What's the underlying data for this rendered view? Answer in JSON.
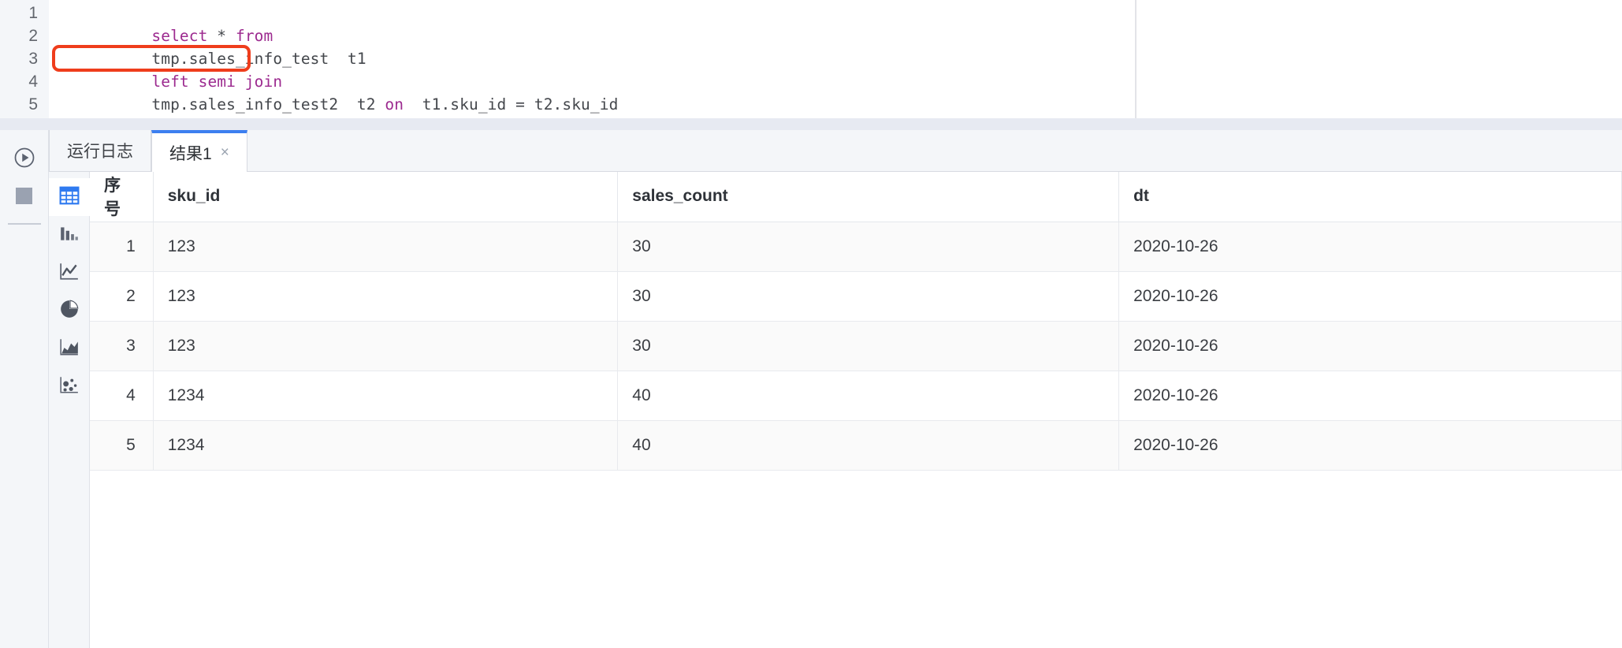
{
  "editor": {
    "line_numbers": [
      "1",
      "2",
      "3",
      "4",
      "5"
    ],
    "lines": [
      {
        "segments": [
          {
            "text": "select ",
            "type": "kw"
          },
          {
            "text": "* ",
            "type": "plain"
          },
          {
            "text": "from",
            "type": "kw"
          }
        ]
      },
      {
        "segments": [
          {
            "text": "tmp.sales_info_test  t1",
            "type": "plain"
          }
        ]
      },
      {
        "segments": [
          {
            "text": "left semi join",
            "type": "kw"
          }
        ]
      },
      {
        "segments": [
          {
            "text": "tmp.sales_info_test2  t2 ",
            "type": "plain"
          },
          {
            "text": "on",
            "type": "kw"
          },
          {
            "text": "  t1.sku_id = t2.sku_id",
            "type": "plain"
          }
        ]
      },
      {
        "segments": []
      }
    ],
    "highlight": {
      "target_line": 3,
      "target_text": "left semi join",
      "color": "#ef3d1c"
    },
    "keyword_color": "#9c2a8f",
    "text_color": "#44474c"
  },
  "run_rail": {
    "items": [
      {
        "icon": "run-play-icon",
        "label": "运行"
      },
      {
        "icon": "stop-square-icon",
        "label": "停止"
      }
    ]
  },
  "tabs": [
    {
      "label": "运行日志",
      "active": false,
      "closable": false
    },
    {
      "label": "结果1",
      "active": true,
      "closable": true,
      "close_label": "×"
    }
  ],
  "viz_rail": {
    "active_index": 0,
    "items": [
      {
        "icon": "table-grid-icon",
        "label": "表格"
      },
      {
        "icon": "bar-chart-icon",
        "label": "柱状图"
      },
      {
        "icon": "line-chart-icon",
        "label": "折线图"
      },
      {
        "icon": "pie-chart-icon",
        "label": "饼图"
      },
      {
        "icon": "area-chart-icon",
        "label": "面积图"
      },
      {
        "icon": "scatter-plot-icon",
        "label": "散点图"
      }
    ]
  },
  "result_table": {
    "columns": [
      "序号",
      "sku_id",
      "sales_count",
      "dt"
    ],
    "rows": [
      {
        "序号": "1",
        "sku_id": "123",
        "sales_count": "30",
        "dt": "2020-10-26"
      },
      {
        "序号": "2",
        "sku_id": "123",
        "sales_count": "30",
        "dt": "2020-10-26"
      },
      {
        "序号": "3",
        "sku_id": "123",
        "sales_count": "30",
        "dt": "2020-10-26"
      },
      {
        "序号": "4",
        "sku_id": "1234",
        "sales_count": "40",
        "dt": "2020-10-26"
      },
      {
        "序号": "5",
        "sku_id": "1234",
        "sales_count": "40",
        "dt": "2020-10-26"
      }
    ]
  },
  "colors": {
    "accent_blue": "#3d7ff0",
    "table_icon_blue": "#2f7af0",
    "highlight_red": "#ef3d1c",
    "panel_bg": "#f4f6f9",
    "separator": "#e7eaf2"
  }
}
